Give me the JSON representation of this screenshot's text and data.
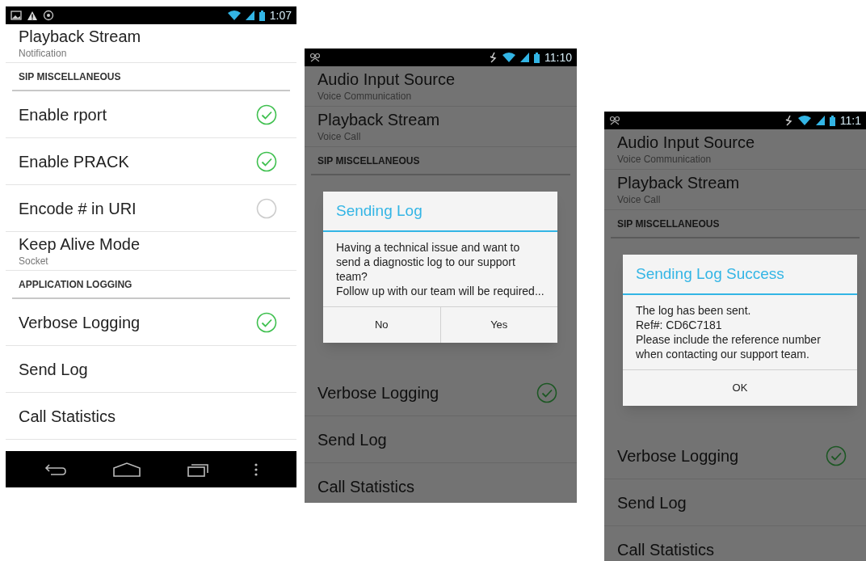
{
  "screens": [
    {
      "status_bar": {
        "time": "1:07"
      },
      "dimmed": false,
      "nav_bar": true,
      "items": [
        {
          "kind": "setting",
          "title": "Playback Stream",
          "subtitle": "Notification"
        },
        {
          "kind": "header",
          "title": "SIP MISCELLANEOUS"
        },
        {
          "kind": "toggle",
          "title": "Enable rport",
          "checked": true
        },
        {
          "kind": "toggle",
          "title": "Enable PRACK",
          "checked": true
        },
        {
          "kind": "toggle",
          "title": "Encode # in URI",
          "checked": false
        },
        {
          "kind": "setting",
          "title": "Keep Alive Mode",
          "subtitle": "Socket"
        },
        {
          "kind": "header",
          "title": "APPLICATION LOGGING"
        },
        {
          "kind": "toggle",
          "title": "Verbose Logging",
          "checked": true
        },
        {
          "kind": "action",
          "title": "Send Log"
        },
        {
          "kind": "action",
          "title": "Call Statistics"
        }
      ]
    },
    {
      "status_bar": {
        "time": "11:10"
      },
      "dimmed": true,
      "nav_bar": false,
      "items": [
        {
          "kind": "setting",
          "title": "Audio Input Source",
          "subtitle": "Voice Communication"
        },
        {
          "kind": "setting",
          "title": "Playback Stream",
          "subtitle": "Voice Call"
        },
        {
          "kind": "header",
          "title": "SIP MISCELLANEOUS"
        },
        {
          "kind": "gap"
        },
        {
          "kind": "toggle",
          "title": "Verbose Logging",
          "checked": true
        },
        {
          "kind": "action",
          "title": "Send Log"
        },
        {
          "kind": "action",
          "title": "Call Statistics"
        }
      ],
      "dialog": {
        "title": "Sending Log",
        "message": [
          "Having a technical issue and want to send a diagnostic log to our support team?",
          "Follow up with our team will be required..."
        ],
        "buttons": [
          "No",
          "Yes"
        ]
      }
    },
    {
      "status_bar": {
        "time": "11:1"
      },
      "dimmed": true,
      "nav_bar": false,
      "items": [
        {
          "kind": "setting",
          "title": "Audio Input Source",
          "subtitle": "Voice Communication"
        },
        {
          "kind": "setting",
          "title": "Playback Stream",
          "subtitle": "Voice Call"
        },
        {
          "kind": "header",
          "title": "SIP MISCELLANEOUS"
        },
        {
          "kind": "gap"
        },
        {
          "kind": "toggle",
          "title": "Verbose Logging",
          "checked": true
        },
        {
          "kind": "action",
          "title": "Send Log"
        },
        {
          "kind": "action",
          "title": "Call Statistics"
        }
      ],
      "dialog": {
        "title": "Sending Log Success",
        "message": [
          "The log has been sent.",
          "Ref#: CD6C7181",
          "Please include the reference number when contacting our support team."
        ],
        "buttons": [
          "OK"
        ]
      }
    }
  ]
}
